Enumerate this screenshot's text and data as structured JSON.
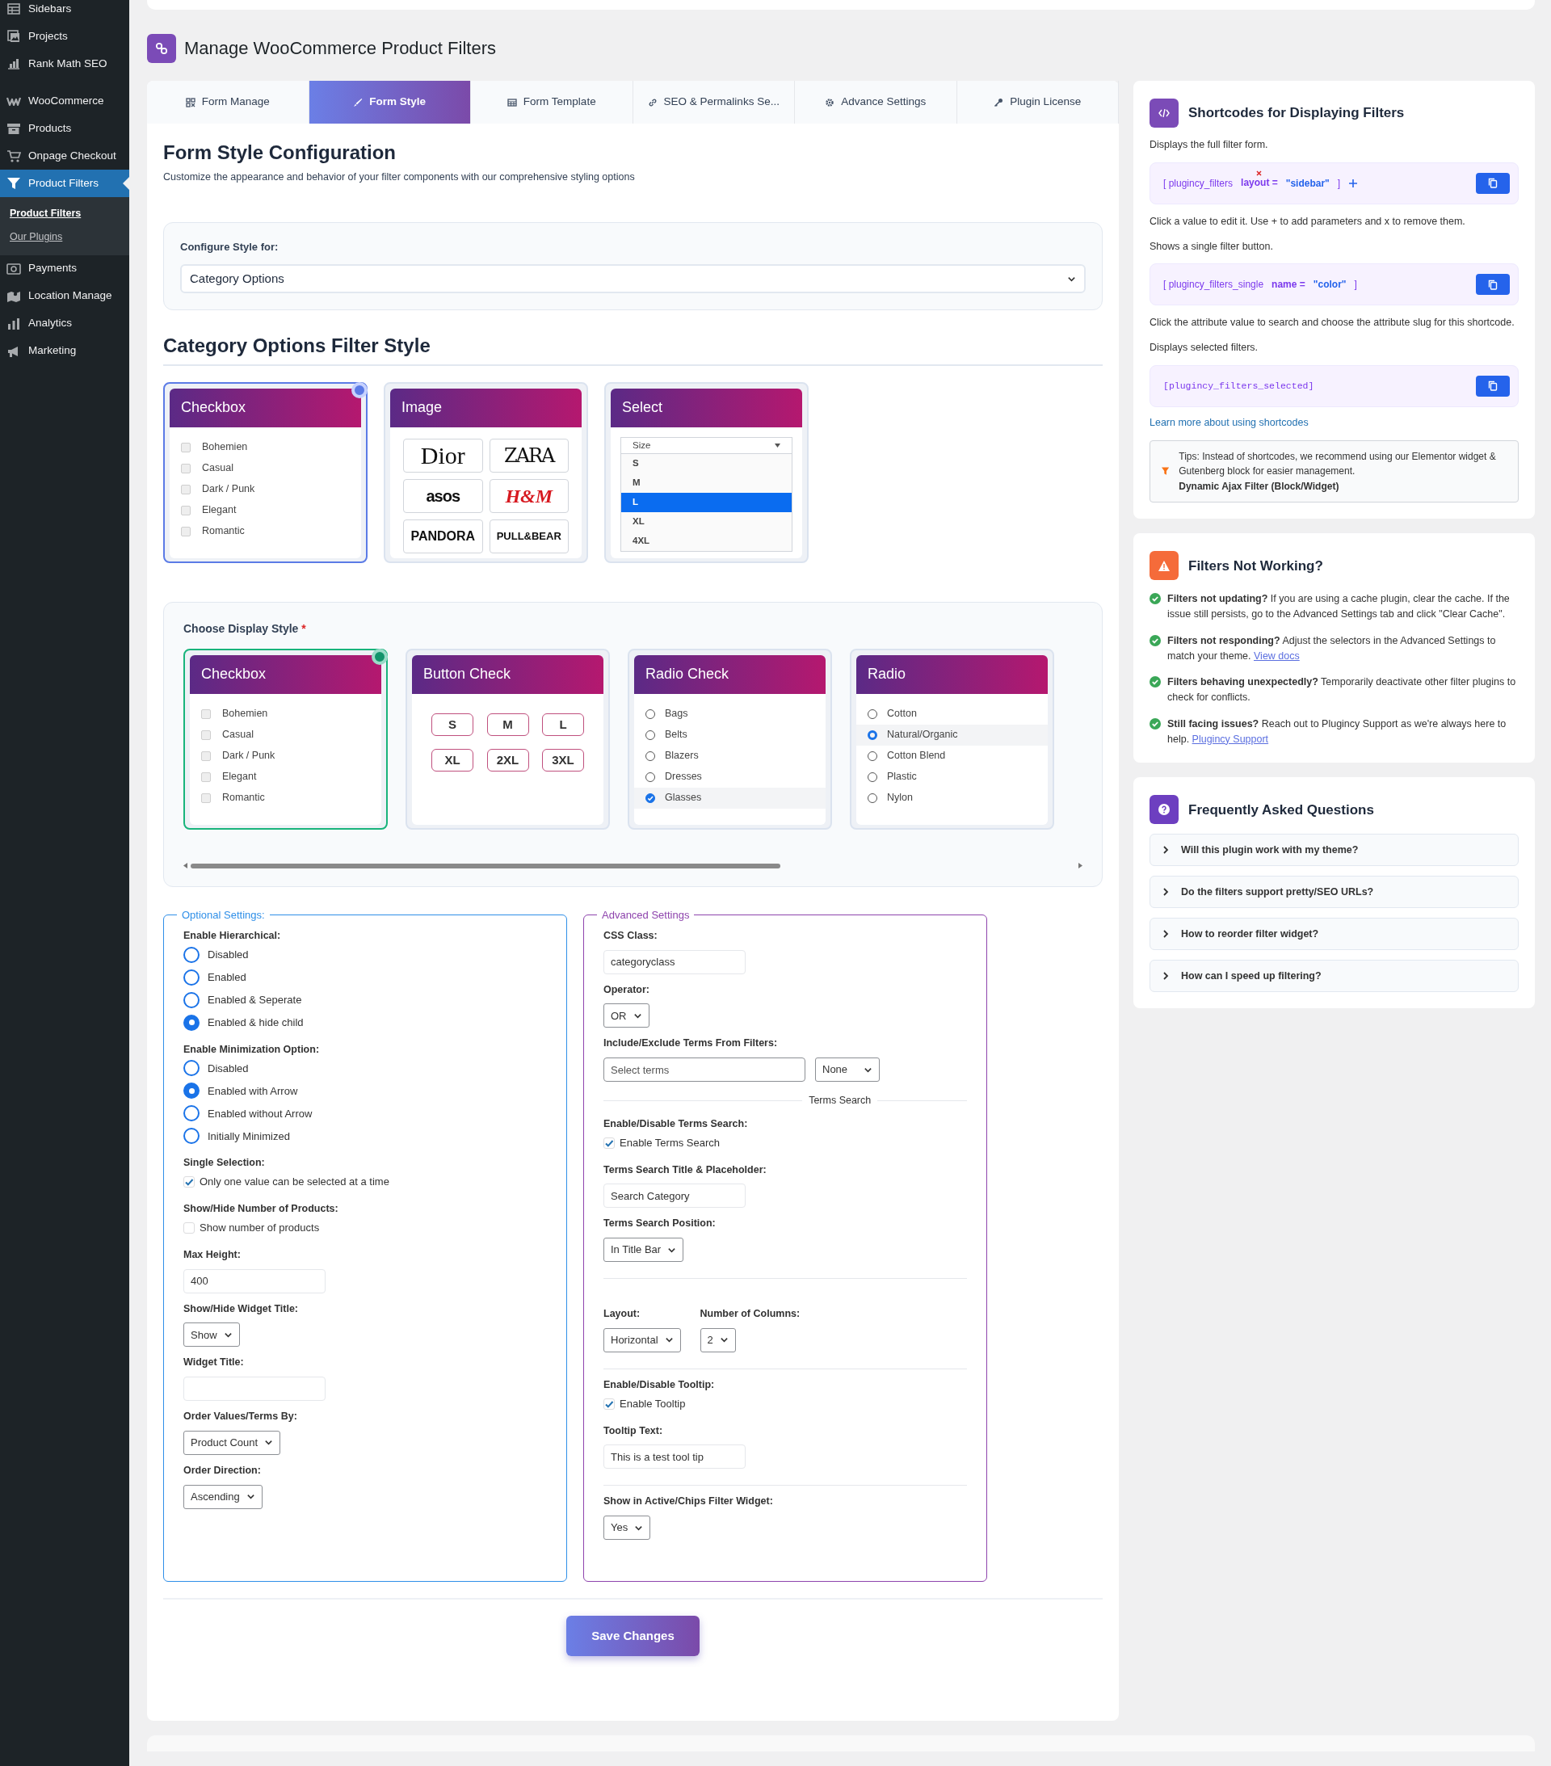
{
  "sidebar": {
    "items": [
      {
        "label": "Sidebars",
        "selected": false
      },
      {
        "label": "Projects",
        "selected": false
      },
      {
        "label": "Rank Math SEO",
        "selected": false
      },
      {
        "label": "WooCommerce",
        "selected": false
      },
      {
        "label": "Products",
        "selected": false
      },
      {
        "label": "Onpage Checkout",
        "selected": false
      },
      {
        "label": "Product Filters",
        "selected": true,
        "children": [
          {
            "label": "Product Filters",
            "selected": true
          },
          {
            "label": "Our Plugins",
            "selected": false
          }
        ]
      },
      {
        "label": "Payments",
        "selected": false
      },
      {
        "label": "Location Manage",
        "selected": false
      },
      {
        "label": "Analytics",
        "selected": false
      },
      {
        "label": "Marketing",
        "selected": false
      }
    ]
  },
  "page_title": "Manage WooCommerce Product Filters",
  "tabs": [
    {
      "label": "Form Manage",
      "selected": false
    },
    {
      "label": "Form Style",
      "selected": true
    },
    {
      "label": "Form Template",
      "selected": false
    },
    {
      "label": "SEO & Permalinks Se...",
      "selected": false
    },
    {
      "label": "Advance Settings",
      "selected": false
    },
    {
      "label": "Plugin License",
      "selected": false
    }
  ],
  "intro": {
    "title": "Form Style Configuration",
    "subtitle": "Customize the appearance and behavior of your filter components with our comprehensive styling options"
  },
  "configure": {
    "label": "Configure Style for:",
    "value": "Category Options"
  },
  "filter_style": {
    "title": "Category Options Filter Style",
    "cards": [
      {
        "kind": "checkbox",
        "title": "Checkbox",
        "selected": true,
        "items": [
          {
            "label": "Bohemien",
            "checked": false
          },
          {
            "label": "Casual",
            "checked": false
          },
          {
            "label": "Dark / Punk",
            "checked": false
          },
          {
            "label": "Elegant",
            "checked": false
          },
          {
            "label": "Romantic",
            "checked": false
          }
        ]
      },
      {
        "kind": "image",
        "title": "Image",
        "selected": false,
        "logos": [
          "Dior",
          "ZARA",
          "asos",
          "H&M",
          "PANDORA",
          "PULL&BEAR"
        ]
      },
      {
        "kind": "select",
        "title": "Select",
        "selected": false,
        "placeholder": "Size",
        "options": [
          {
            "label": "S",
            "selected": false
          },
          {
            "label": "M",
            "selected": false
          },
          {
            "label": "L",
            "selected": true
          },
          {
            "label": "XL",
            "selected": false
          },
          {
            "label": "4XL",
            "selected": false
          }
        ]
      }
    ]
  },
  "display_style": {
    "label": "Choose Display Style",
    "required_mark": "*",
    "cards": [
      {
        "kind": "checkbox",
        "title": "Checkbox",
        "selected": true,
        "items": [
          {
            "label": "Bohemien",
            "checked": false
          },
          {
            "label": "Casual",
            "checked": false
          },
          {
            "label": "Dark / Punk",
            "checked": false
          },
          {
            "label": "Elegant",
            "checked": false
          },
          {
            "label": "Romantic",
            "checked": false
          }
        ]
      },
      {
        "kind": "buttons",
        "title": "Button Check",
        "selected": false,
        "buttons": [
          "S",
          "M",
          "L",
          "XL",
          "2XL",
          "3XL"
        ]
      },
      {
        "kind": "radio_check",
        "title": "Radio Check",
        "selected": false,
        "items": [
          {
            "label": "Bags",
            "selected": false
          },
          {
            "label": "Belts",
            "selected": false
          },
          {
            "label": "Blazers",
            "selected": false
          },
          {
            "label": "Dresses",
            "selected": false
          },
          {
            "label": "Glasses",
            "selected": true
          }
        ]
      },
      {
        "kind": "radio",
        "title": "Radio",
        "selected": false,
        "items": [
          {
            "label": "Cotton",
            "selected": false
          },
          {
            "label": "Natural/Organic",
            "selected": true
          },
          {
            "label": "Cotton Blend",
            "selected": false
          },
          {
            "label": "Plastic",
            "selected": false
          },
          {
            "label": "Nylon",
            "selected": false
          }
        ]
      }
    ]
  },
  "optional_settings": {
    "legend": "Optional Settings:",
    "fields": [
      {
        "kind": "radios",
        "label": "Enable Hierarchical:",
        "options": [
          {
            "label": "Disabled",
            "selected": false
          },
          {
            "label": "Enabled",
            "selected": false
          },
          {
            "label": "Enabled & Seperate",
            "selected": false
          },
          {
            "label": "Enabled & hide child",
            "selected": true
          }
        ]
      },
      {
        "kind": "radios",
        "label": "Enable Minimization Option:",
        "options": [
          {
            "label": "Disabled",
            "selected": false
          },
          {
            "label": "Enabled with Arrow",
            "selected": true
          },
          {
            "label": "Enabled without Arrow",
            "selected": false
          },
          {
            "label": "Initially Minimized",
            "selected": false
          }
        ]
      },
      {
        "kind": "check",
        "label": "Single Selection:",
        "text": "Only one value can be selected at a time",
        "checked": true
      },
      {
        "kind": "check",
        "label": "Show/Hide Number of Products:",
        "text": "Show number of products",
        "checked": false
      },
      {
        "kind": "input",
        "label": "Max Height:",
        "value": "400"
      },
      {
        "kind": "select",
        "label": "Show/Hide Widget Title:",
        "value": "Show"
      },
      {
        "kind": "input",
        "label": "Widget Title:"
      },
      {
        "kind": "select",
        "label": "Order Values/Terms By:",
        "value": "Product Count"
      },
      {
        "kind": "select",
        "label": "Order Direction:",
        "value": "Ascending"
      }
    ]
  },
  "advanced_settings": {
    "legend": "Advanced Settings",
    "fields": [
      {
        "kind": "input",
        "label": "CSS Class:",
        "value": "categoryclass"
      },
      {
        "kind": "select",
        "label": "Operator:",
        "value": "OR"
      },
      {
        "kind": "terms",
        "label": "Include/Exclude Terms From Filters:",
        "placeholder": "Select terms",
        "value": "None"
      },
      {
        "kind": "divider",
        "label": "Terms Search"
      },
      {
        "kind": "check",
        "label": "Enable/Disable Terms Search:",
        "text": "Enable Terms Search",
        "checked": true
      },
      {
        "kind": "input",
        "label": "Terms Search Title & Placeholder:",
        "value": "Search Category"
      },
      {
        "kind": "select",
        "label": "Terms Search Position:",
        "value": "In Title Bar"
      },
      {
        "kind": "rule"
      },
      {
        "kind": "pair",
        "items": [
          {
            "label": "Layout:",
            "value": "Horizontal"
          },
          {
            "label": "Number of Columns:",
            "value": "2"
          }
        ]
      },
      {
        "kind": "rule"
      },
      {
        "kind": "check",
        "label": "Enable/Disable Tooltip:",
        "text": "Enable Tooltip",
        "checked": true
      },
      {
        "kind": "input",
        "label": "Tooltip Text:",
        "value": "This is a test tool tip"
      },
      {
        "kind": "rule"
      },
      {
        "kind": "select",
        "label": "Show in Active/Chips Filter Widget:",
        "value": "Yes"
      }
    ]
  },
  "save_label": "Save Changes",
  "shortcodes": {
    "title": "Shortcodes for Displaying Filters",
    "blocks": [
      {
        "description": "Displays the full filter form.",
        "kind": "attrs",
        "tag": "[ plugincy_filters",
        "attr": "layout =",
        "removable": true,
        "value": "\"sidebar\"",
        "close": "]",
        "addable": true,
        "note": "Click a value to edit it. Use + to add parameters and x to remove them."
      },
      {
        "description": "Shows a single filter button.",
        "kind": "attrs",
        "tag": "[ plugincy_filters_single",
        "attr": "name =",
        "removable": false,
        "value": "\"color\"",
        "close": "]",
        "addable": false,
        "note": "Click the attribute value to search and choose the attribute slug for this shortcode."
      },
      {
        "description": "Displays selected filters.",
        "kind": "mono",
        "code": "[plugincy_filters_selected]"
      }
    ],
    "link": "Learn more about using shortcodes",
    "tip": "Tips: Instead of shortcodes, we recommend using our Elementor widget & Gutenberg block for easier management.",
    "tip_strong": "Dynamic Ajax Filter (Block/Widget)"
  },
  "troubleshooting": {
    "title": "Filters Not Working?",
    "items": [
      {
        "text": "**Filters not updating?** If you are using a cache plugin, clear the cache. If the issue still persists, go to the Advanced Settings tab and click \"Clear Cache\"."
      },
      {
        "text": "**Filters not responding?** Adjust the selectors in the Advanced Settings to match your theme.",
        "link": "View docs"
      },
      {
        "text": "**Filters behaving unexpectedly?** Temporarily deactivate other filter plugins to check for conflicts."
      },
      {
        "text": "**Still facing issues?** Reach out to Plugincy Support as we're always here to help.",
        "link": "Plugincy Support"
      }
    ]
  },
  "faq": {
    "title": "Frequently Asked Questions",
    "items": [
      {
        "question": "Will this plugin work with my theme?",
        "expanded": false
      },
      {
        "question": "Do the filters support pretty/SEO URLs?",
        "expanded": false
      },
      {
        "question": "How to reorder filter widget?",
        "expanded": false
      },
      {
        "question": "How can I speed up filtering?",
        "expanded": false
      }
    ]
  }
}
